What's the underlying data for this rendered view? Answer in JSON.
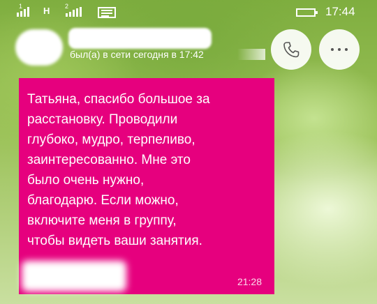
{
  "status_bar": {
    "sim1": {
      "number": "1",
      "network": "H"
    },
    "sim2": {
      "number": "2"
    },
    "time": "17:44"
  },
  "header": {
    "last_seen": "был(а) в сети сегодня в 17:42"
  },
  "message": {
    "lines": [
      "Татьяна, спасибо большое за",
      "расстановку. Проводили",
      "глубоко, мудро, терпеливо,",
      "заинтересованно. Мне это",
      "было очень нужно,",
      "благодарю. Если можно,",
      "включите меня в группу,",
      "чтобы видеть ваши занятия."
    ],
    "time": "21:28"
  },
  "colors": {
    "bubble": "#e6007e",
    "text": "#ffffff"
  },
  "icons": {
    "call": "phone-icon",
    "more": "more-dots-icon"
  }
}
